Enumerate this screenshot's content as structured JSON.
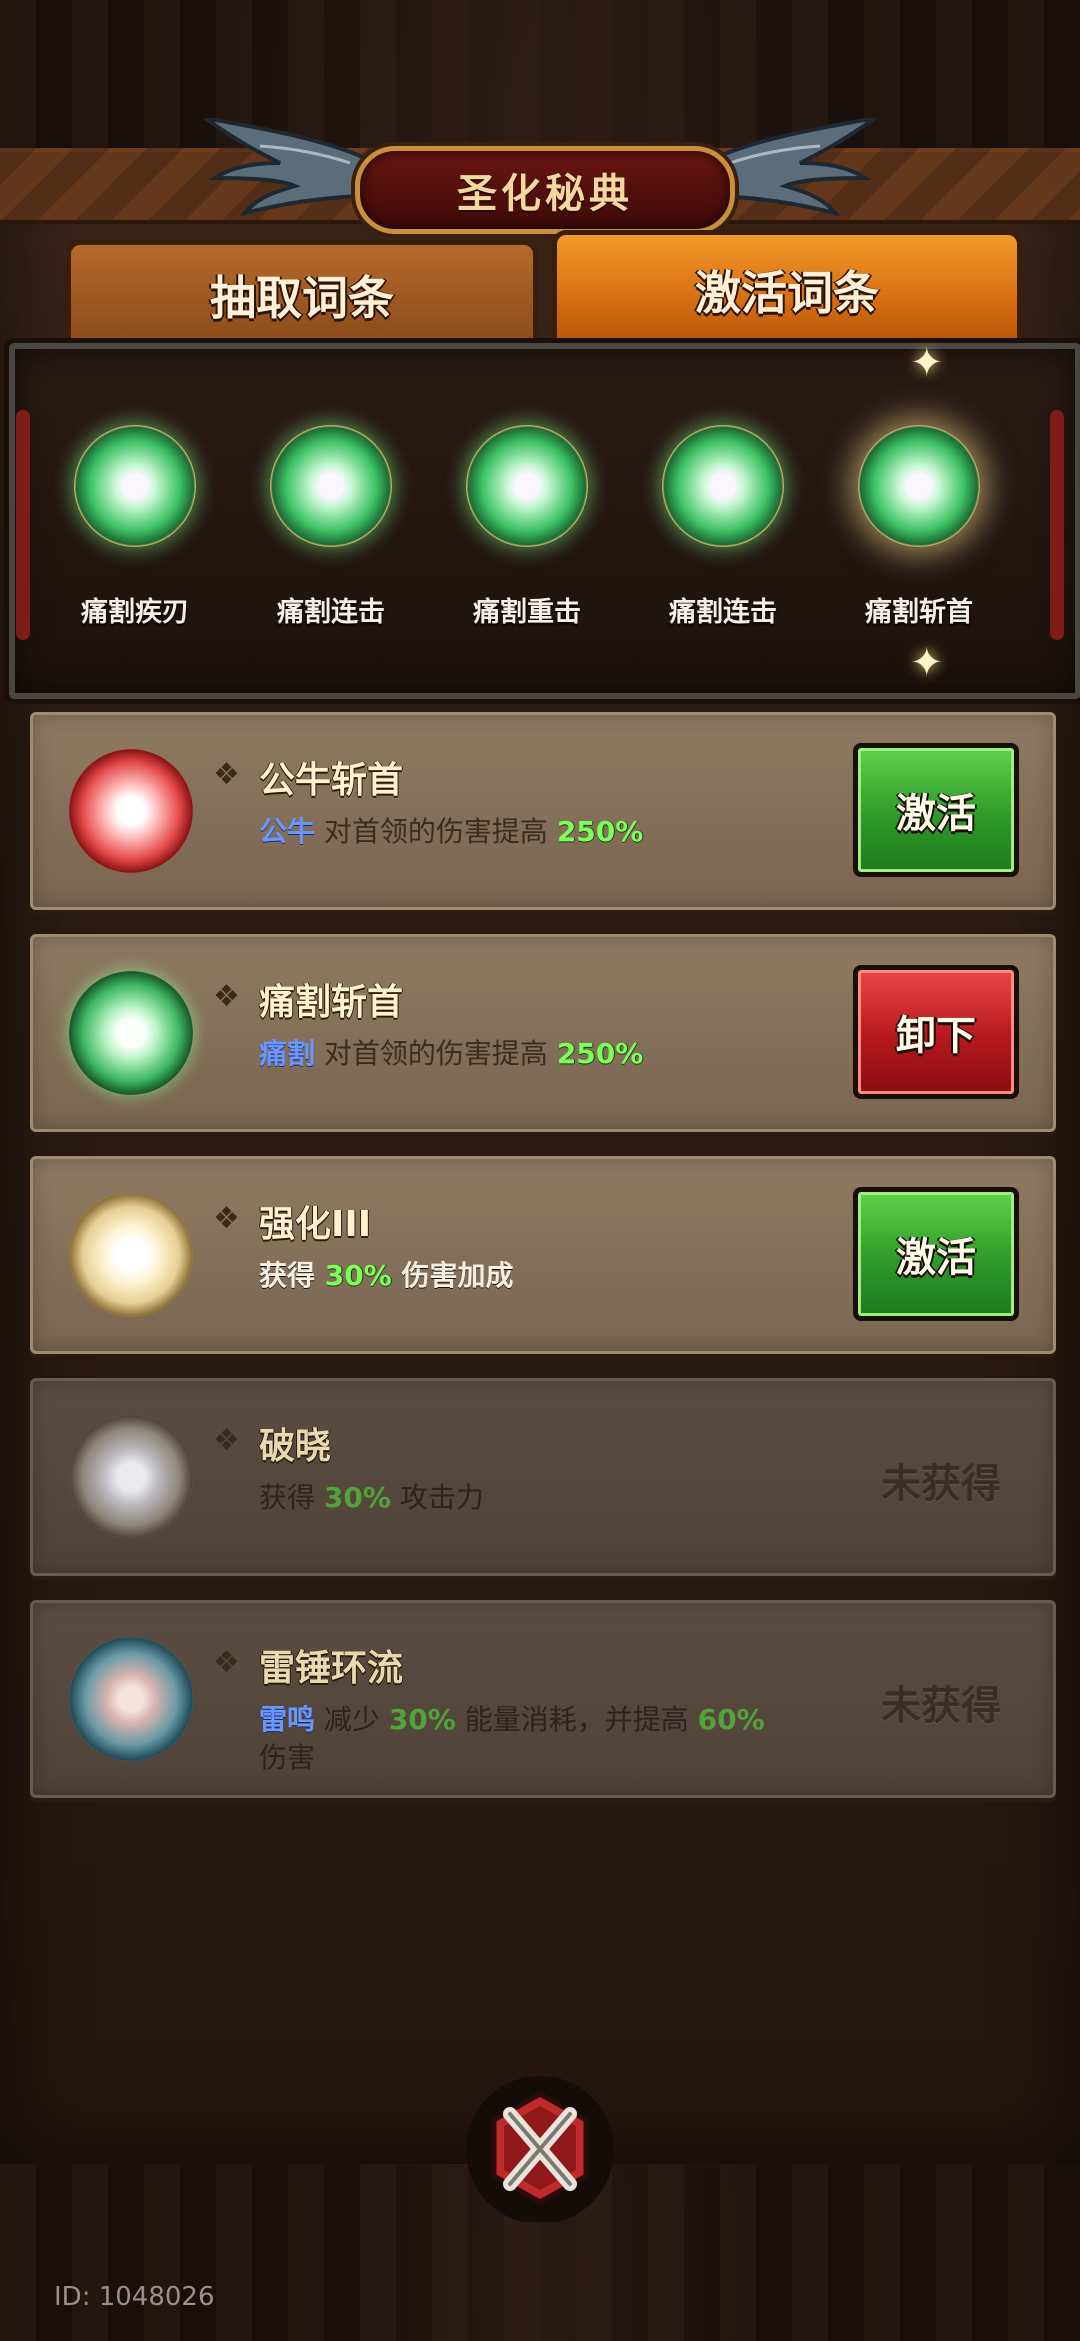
{
  "title": "圣化秘典",
  "tabs": [
    {
      "label": "抽取词条",
      "active": false
    },
    {
      "label": "激活词条",
      "active": true
    }
  ],
  "slots": [
    {
      "label": "痛割疾刃"
    },
    {
      "label": "痛割连击"
    },
    {
      "label": "痛割重击"
    },
    {
      "label": "痛割连击"
    },
    {
      "label": "痛割斩首",
      "selected": true
    }
  ],
  "entries": [
    {
      "title": "公牛斩首",
      "orb": "red",
      "desc": [
        {
          "t": "公牛",
          "s": "kw"
        },
        {
          "t": " 对首领的伤害提高 ",
          "s": "plain-dark"
        },
        {
          "t": "250%",
          "s": "num"
        }
      ],
      "action": {
        "label": "激活",
        "style": "green"
      }
    },
    {
      "title": "痛割斩首",
      "orb": "green",
      "desc": [
        {
          "t": "痛割",
          "s": "kw"
        },
        {
          "t": " 对首领的伤害提高 ",
          "s": "plain-dark"
        },
        {
          "t": "250%",
          "s": "num"
        }
      ],
      "action": {
        "label": "卸下",
        "style": "red"
      }
    },
    {
      "title": "强化III",
      "orb": "gold",
      "desc": [
        {
          "t": "获得 ",
          "s": "plain-light"
        },
        {
          "t": "30%",
          "s": "num"
        },
        {
          "t": " 伤害加成",
          "s": "plain-light"
        }
      ],
      "action": {
        "label": "激活",
        "style": "green"
      }
    },
    {
      "title": "破晓",
      "orb": "gray",
      "locked": true,
      "desc": [
        {
          "t": "获得 ",
          "s": "plain-dark"
        },
        {
          "t": "30%",
          "s": "num"
        },
        {
          "t": " 攻击力",
          "s": "plain-dark"
        }
      ],
      "status": "未获得"
    },
    {
      "title": "雷锤环流",
      "orb": "teal",
      "locked": true,
      "desc": [
        {
          "t": "雷鸣",
          "s": "kw"
        },
        {
          "t": " 减少 ",
          "s": "plain-dark"
        },
        {
          "t": "30%",
          "s": "num"
        },
        {
          "t": " 能量消耗，并提高 ",
          "s": "plain-dark"
        },
        {
          "t": "60%",
          "s": "num"
        },
        {
          "t": " 伤害",
          "s": "plain-dark"
        }
      ],
      "status": "未获得"
    }
  ],
  "player_id": "ID: 1048026",
  "colors": {
    "accent": "#d66d12",
    "green": "#2f9a29",
    "red": "#b5181c",
    "keyword": "#6a96ff",
    "number": "#7dff5a"
  }
}
